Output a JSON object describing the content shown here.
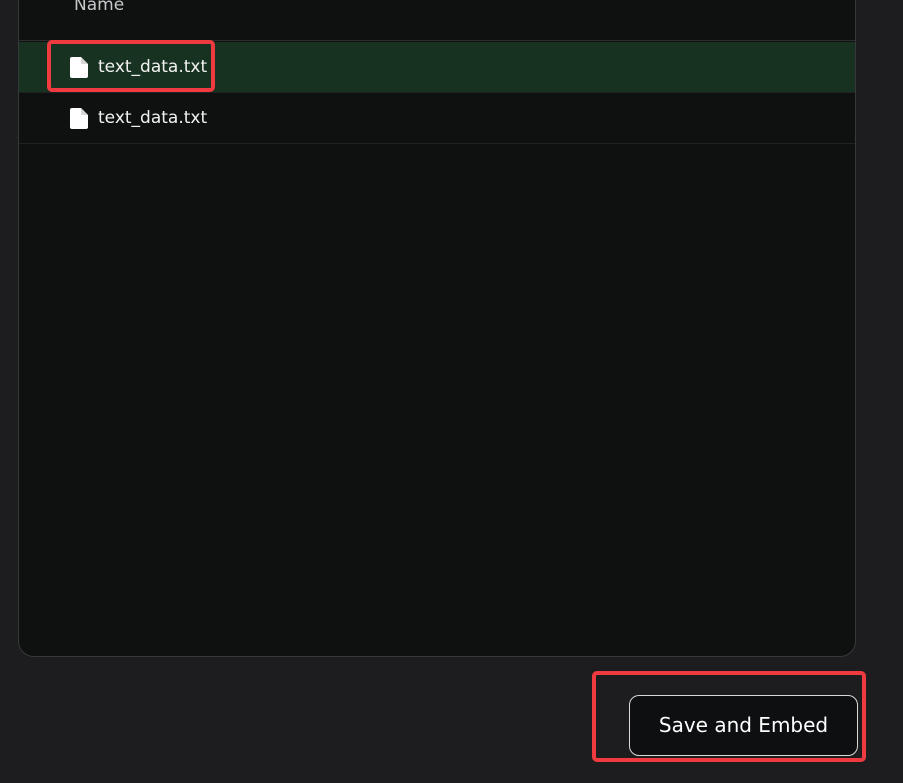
{
  "file_table": {
    "header": {
      "name_label": "Name"
    },
    "rows": [
      {
        "name": "text_data.txt",
        "icon": "file-icon",
        "selected": true
      },
      {
        "name": "text_data.txt",
        "icon": "file-icon",
        "selected": false
      }
    ]
  },
  "actions": {
    "save_and_embed_label": "Save and Embed"
  },
  "colors": {
    "background": "#1d1d20",
    "panel": "#0f1111",
    "selected_row": "#173220",
    "highlight": "#ef3b3f",
    "text": "#f2f2f2"
  }
}
